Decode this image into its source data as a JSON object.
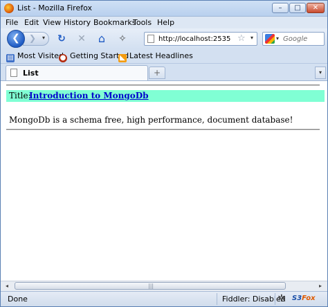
{
  "window": {
    "title": "List - Mozilla Firefox",
    "minimize_glyph": "–",
    "maximize_glyph": "□",
    "close_glyph": "✕"
  },
  "menu": [
    "File",
    "Edit",
    "View",
    "History",
    "Bookmarks",
    "Tools",
    "Help"
  ],
  "nav": {
    "back_glyph": "❮",
    "forward_glyph": "❯",
    "dropdown_glyph": "▾",
    "reload_glyph": "↻",
    "stop_glyph": "✕",
    "home_glyph": "⌂",
    "addon_glyph": "✧",
    "url": "http://localhost:2535/",
    "star_glyph": "☆",
    "search_placeholder": "Google",
    "icons": {
      "back": "back-arrow-icon",
      "forward": "forward-arrow-icon",
      "reload": "reload-icon",
      "stop": "stop-icon",
      "home": "home-icon",
      "bookmark": "star-icon",
      "search_engine": "google-icon"
    }
  },
  "bookmarks": [
    {
      "label": "Most Visited",
      "icon": "most-visited-icon",
      "glyph": "▤"
    },
    {
      "label": "Getting Started",
      "icon": "firefox-icon",
      "glyph": "●"
    },
    {
      "label": "Latest Headlines",
      "icon": "rss-icon",
      "glyph": "◣"
    }
  ],
  "tabs": [
    {
      "label": "List",
      "active": true
    }
  ],
  "tab_controls": {
    "new_tab_glyph": "+",
    "list_glyph": "▾"
  },
  "page": {
    "title_label": "Title:",
    "title_link": "Introduction to MongoDb",
    "description": "MongoDb is a schema free, high performance, document database!",
    "title_row_color": "#80ffd4"
  },
  "scrollbar": {
    "left_glyph": "◂",
    "right_glyph": "▸",
    "grip_glyph": "|||"
  },
  "status": {
    "text": "Done",
    "fiddler": "Fiddler: Disabled",
    "gear_glyph": "✲",
    "s3_a": "S3",
    "s3_b": "Fox"
  }
}
